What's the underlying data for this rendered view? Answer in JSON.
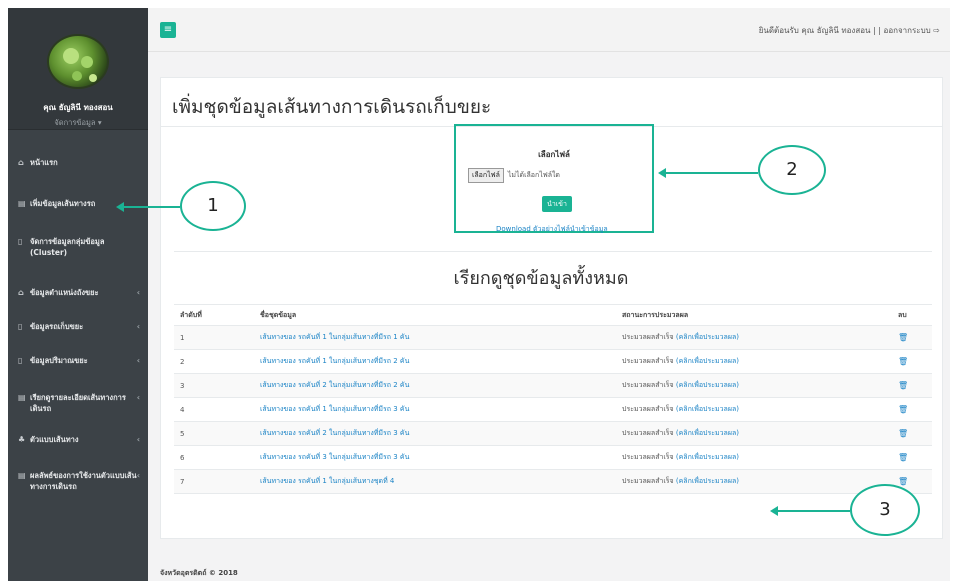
{
  "user": {
    "name": "คุณ ธัญลินี ทองสอน",
    "role": "จัดการข้อมูล ▾"
  },
  "sidebar": {
    "items": [
      {
        "icon": "home-icon",
        "glyph": "⌂",
        "label": "หน้าแรก",
        "chevron": ""
      },
      {
        "icon": "table-icon",
        "glyph": "▤",
        "label": "เพิ่มข้อมูลเส้นทางรถ",
        "chevron": ""
      },
      {
        "icon": "file-icon",
        "glyph": "▯",
        "label": "จัดการข้อมูลกลุ่มข้อมูล (Cluster)",
        "chevron": ""
      },
      {
        "icon": "home-icon",
        "glyph": "⌂",
        "label": "ข้อมูลตำแหน่งถังขยะ",
        "chevron": "‹"
      },
      {
        "icon": "file-icon",
        "glyph": "▯",
        "label": "ข้อมูลรถเก็บขยะ",
        "chevron": "‹"
      },
      {
        "icon": "file-icon",
        "glyph": "▯",
        "label": "ข้อมูลปริมาณขยะ",
        "chevron": "‹"
      },
      {
        "icon": "table-icon",
        "glyph": "▤",
        "label": "เรียกดูรายละเอียดเส้นทางการเดินรถ",
        "chevron": "‹"
      },
      {
        "icon": "team-icon",
        "glyph": "♣",
        "label": "ตัวแบบเส้นทาง",
        "chevron": "‹"
      },
      {
        "icon": "table-icon",
        "glyph": "▤",
        "label": "ผลลัพธ์ของการใช้งานตัวแบบเส้นทางการเดินรถ",
        "chevron": "‹"
      }
    ]
  },
  "header": {
    "menu_glyph": "≡",
    "welcome": "ยินดีต้อนรับ คุณ ธัญลินี ทองสอน | | ออกจากระบบ ⇨"
  },
  "page": {
    "title": "เพิ่มชุดข้อมูลเส้นทางการเดินรถเก็บขยะ"
  },
  "upload": {
    "title": "เลือกไฟล์",
    "file_button": "เลือกไฟล์",
    "file_status": "ไม่ได้เลือกไฟล์ใด",
    "submit": "นำเข้า",
    "download": "Download ตัวอย่างไฟล์นำเข้าข้อมูล"
  },
  "section": {
    "title": "เรียกดูชุดข้อมูลทั้งหมด"
  },
  "table": {
    "headers": [
      "ลำดับที่",
      "ชื่อชุดข้อมูล",
      "สถานะการประมวลผล",
      "ลบ"
    ],
    "rows": [
      {
        "no": "1",
        "name": "เส้นทางของ รถคันที่ 1 ในกลุ่มเส้นทางที่มีรถ 1 คัน",
        "status": "ประมวลผลสำเร็จ",
        "link": "(คลิกเพื่อประมวลผล)"
      },
      {
        "no": "2",
        "name": "เส้นทางของ รถคันที่ 1 ในกลุ่มเส้นทางที่มีรถ 2 คัน",
        "status": "ประมวลผลสำเร็จ",
        "link": "(คลิกเพื่อประมวลผล)"
      },
      {
        "no": "3",
        "name": "เส้นทางของ รถคันที่ 2 ในกลุ่มเส้นทางที่มีรถ 2 คัน",
        "status": "ประมวลผลสำเร็จ",
        "link": "(คลิกเพื่อประมวลผล)"
      },
      {
        "no": "4",
        "name": "เส้นทางของ รถคันที่ 1 ในกลุ่มเส้นทางที่มีรถ 3 คัน",
        "status": "ประมวลผลสำเร็จ",
        "link": "(คลิกเพื่อประมวลผล)"
      },
      {
        "no": "5",
        "name": "เส้นทางของ รถคันที่ 2 ในกลุ่มเส้นทางที่มีรถ 3 คัน",
        "status": "ประมวลผลสำเร็จ",
        "link": "(คลิกเพื่อประมวลผล)"
      },
      {
        "no": "6",
        "name": "เส้นทางของ รถคันที่ 3 ในกลุ่มเส้นทางที่มีรถ 3 คัน",
        "status": "ประมวลผลสำเร็จ",
        "link": "(คลิกเพื่อประมวลผล)"
      },
      {
        "no": "7",
        "name": "เส้นทางของ รถคันที่ 1 ในกลุ่มเส้นทางชุดที่ 4",
        "status": "ประมวลผลสำเร็จ",
        "link": "(คลิกเพื่อประมวลผล)"
      }
    ],
    "trash_glyph": "🗑"
  },
  "footer": {
    "text": "จังหวัดอุตรดิตถ์ © 2018"
  },
  "callouts": {
    "one": "1",
    "two": "2",
    "three": "3"
  },
  "colors": {
    "accent": "#1ab394",
    "sidebar": "#3c4247",
    "link": "#1c84c6"
  }
}
